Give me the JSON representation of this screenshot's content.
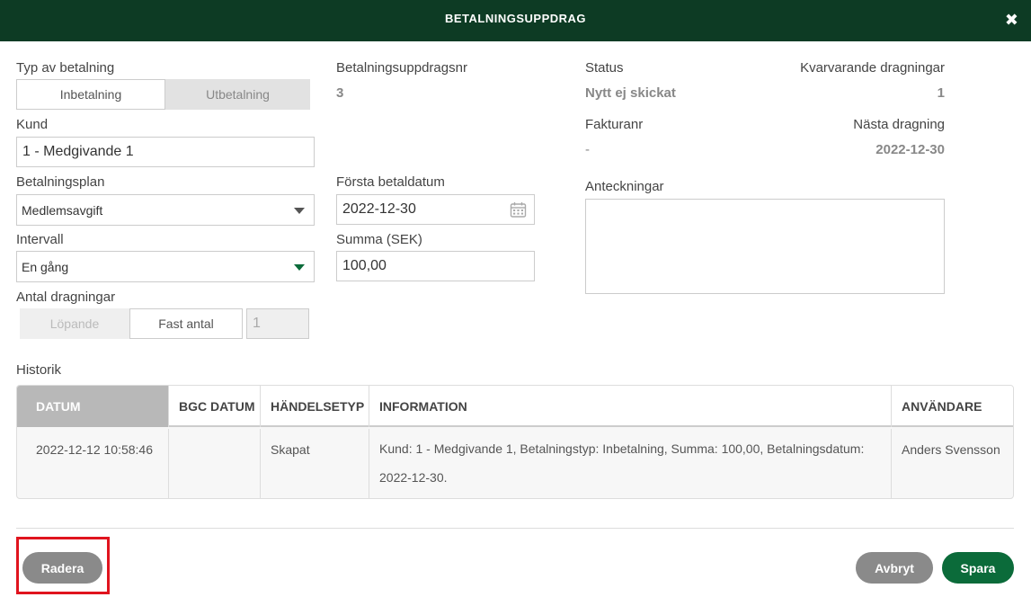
{
  "header": {
    "title": "BETALNINGSUPPDRAG",
    "close_icon": "close-icon",
    "close_glyph": "✖"
  },
  "form": {
    "payment_type": {
      "label": "Typ av betalning",
      "options": [
        "Inbetalning",
        "Utbetalning"
      ],
      "selected": "Inbetalning"
    },
    "customer": {
      "label": "Kund",
      "value": "1 - Medgivande 1"
    },
    "payment_plan": {
      "label": "Betalningsplan",
      "value": "Medlemsavgift"
    },
    "interval": {
      "label": "Intervall",
      "value": "En gång"
    },
    "num_withdrawals": {
      "label": "Antal dragningar",
      "options": [
        "Löpande",
        "Fast antal"
      ],
      "selected": "Fast antal",
      "value": "1"
    },
    "order_number": {
      "label": "Betalningsuppdragsnr",
      "value": "3"
    },
    "first_pay_date": {
      "label": "Första betaldatum",
      "value": "2022-12-30",
      "icon": "calendar-icon"
    },
    "amount": {
      "label": "Summa (SEK)",
      "value": "100,00"
    },
    "status": {
      "label": "Status",
      "value": "Nytt ej skickat"
    },
    "remaining": {
      "label": "Kvarvarande dragningar",
      "value": "1"
    },
    "invoice_no": {
      "label": "Fakturanr",
      "value": "-"
    },
    "next_withdrawal": {
      "label": "Nästa dragning",
      "value": "2022-12-30"
    },
    "notes": {
      "label": "Anteckningar",
      "value": ""
    }
  },
  "history": {
    "label": "Historik",
    "columns": [
      "DATUM",
      "BGC DATUM",
      "HÄNDELSETYP",
      "INFORMATION",
      "ANVÄNDARE"
    ],
    "rows": [
      {
        "datum": "2022-12-12 10:58:46",
        "bgc_datum": "",
        "handelsetyp": "Skapat",
        "information": "Kund: 1 - Medgivande 1, Betalningstyp: Inbetalning, Summa: 100,00, Betalningsdatum: 2022-12-30.",
        "anvandare": "Anders Svensson"
      }
    ]
  },
  "footer": {
    "delete": "Radera",
    "cancel": "Avbryt",
    "save": "Spara"
  },
  "colors": {
    "header_bg": "#0d3b24",
    "primary": "#0b6b3a",
    "grey_button": "#8a8a8a",
    "highlight": "#e0141e"
  }
}
